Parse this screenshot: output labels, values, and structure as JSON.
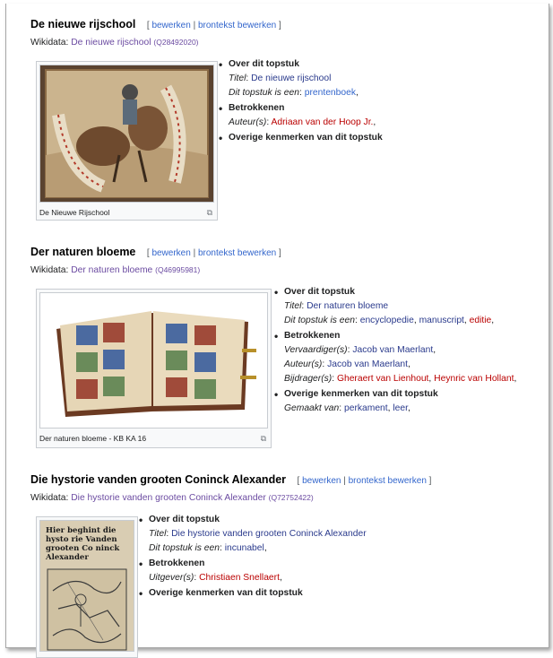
{
  "sections": [
    {
      "title": "De nieuwe rijschool",
      "edit_open": "[",
      "edit_link": "bewerken",
      "edit_sep": "|",
      "source_link": "brontekst bewerken",
      "edit_close": "]",
      "wikidata_label": "Wikidata:",
      "wikidata_link": "De nieuwe rijschool",
      "qid": "(Q28492020)",
      "caption": "De Nieuwe Rijschool",
      "about": "Over dit topstuk",
      "title_label": "Titel",
      "title_value": "De nieuwe rijschool",
      "type_label": "Dit topstuk is een",
      "type_values": [
        "prentenboek"
      ],
      "people": "Betrokkenen",
      "author_label": "Auteur(s)",
      "author_values": [
        "Adriaan van der Hoop Jr."
      ],
      "other": "Overige kenmerken van dit topstuk"
    },
    {
      "title": "Der naturen bloeme",
      "edit_open": "[",
      "edit_link": "bewerken",
      "edit_sep": "|",
      "source_link": "brontekst bewerken",
      "edit_close": "]",
      "wikidata_label": "Wikidata:",
      "wikidata_link": "Der naturen bloeme",
      "qid": "(Q46995981)",
      "caption": "Der naturen bloeme - KB KA 16",
      "about": "Over dit topstuk",
      "title_label": "Titel",
      "title_value": "Der naturen bloeme",
      "type_label": "Dit topstuk is een",
      "type_values": [
        "encyclopedie",
        "manuscript",
        "editie"
      ],
      "people": "Betrokkenen",
      "maker_label": "Vervaardiger(s)",
      "maker_values": [
        "Jacob van Maerlant"
      ],
      "author_label": "Auteur(s)",
      "author_values": [
        "Jacob van Maerlant"
      ],
      "contrib_label": "Bijdrager(s)",
      "contrib_values": [
        "Gheraert van Lienhout",
        "Heynric van Hollant"
      ],
      "other": "Overige kenmerken van dit topstuk",
      "made_label": "Gemaakt van",
      "made_values": [
        "perkament",
        "leer"
      ]
    },
    {
      "title": "Die hystorie vanden grooten Coninck Alexander",
      "edit_open": "[",
      "edit_link": "bewerken",
      "edit_sep": "|",
      "source_link": "brontekst bewerken",
      "edit_close": "]",
      "wikidata_label": "Wikidata:",
      "wikidata_link": "Die hystorie vanden grooten Coninck Alexander",
      "qid": "(Q72752422)",
      "about": "Over dit topstuk",
      "title_label": "Titel",
      "title_value": "Die hystorie vanden grooten Coninck Alexander",
      "type_label": "Dit topstuk is een",
      "type_values": [
        "incunabel"
      ],
      "people": "Betrokkenen",
      "publisher_label": "Uitgever(s)",
      "publisher_values": [
        "Christiaen Snellaert"
      ],
      "other": "Overige kenmerken van dit topstuk",
      "woodcut_text": "Hier beghint die hysto rie Vanden grooten Co ninck Alexander"
    }
  ],
  "icons": {
    "enlarge": "enlarge-icon"
  }
}
